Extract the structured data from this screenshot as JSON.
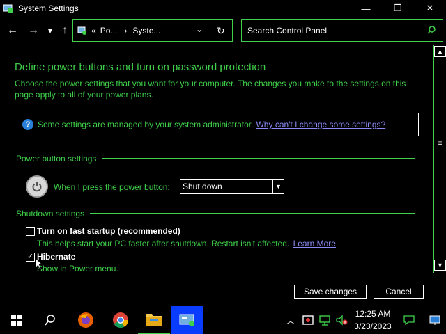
{
  "window": {
    "title": "System Settings",
    "minimize": "—",
    "maximize": "❐",
    "close": "✕"
  },
  "nav": {
    "back": "←",
    "forward": "→",
    "recent": "▾",
    "up": "↑",
    "address_prefix": "«",
    "address_part1": "Po...",
    "address_sep": "›",
    "address_part2": "Syste...",
    "address_dropdown": "⌄",
    "refresh": "↻",
    "search_placeholder": "Search Control Panel"
  },
  "content": {
    "heading": "Define power buttons and turn on password protection",
    "description": "Choose the power settings that you want for your computer. The changes you make to the settings on this page apply to all of your power plans.",
    "info_text": "Some settings are managed by your system administrator.",
    "info_link": "Why can't I change some settings?",
    "power_section_title": "Power button settings",
    "power_label": "When I press the power button:",
    "power_option": "Shut down",
    "shutdown_section_title": "Shutdown settings",
    "fast_startup_label": "Turn on fast startup (recommended)",
    "fast_startup_desc": "This helps start your PC faster after shutdown. Restart isn't affected.",
    "learn_more": "Learn More",
    "fast_startup_checked": false,
    "hibernate_label": "Hibernate",
    "hibernate_desc": "Show in Power menu.",
    "hibernate_checked": true
  },
  "buttons": {
    "save": "Save changes",
    "cancel": "Cancel"
  },
  "taskbar": {
    "time": "12:25 AM",
    "date": "3/23/2023"
  },
  "colors": {
    "accent": "#3fd14a",
    "link": "#8a8af5",
    "background": "#000000"
  }
}
